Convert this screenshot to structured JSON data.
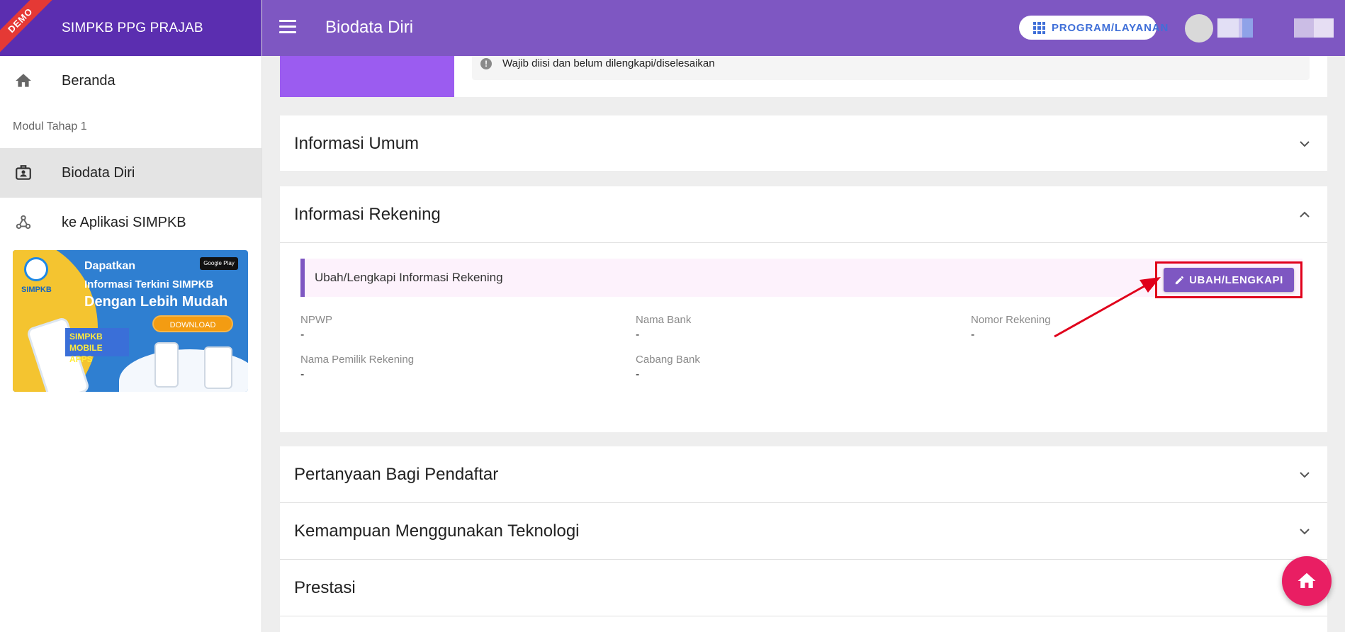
{
  "sidebar": {
    "brand": "SIMPKB PPG PRAJAB",
    "ribbon": "DEMO",
    "items": [
      {
        "label": "Beranda",
        "icon": "home-icon"
      },
      {
        "label": "Biodata Diri",
        "icon": "id-badge-icon"
      },
      {
        "label": "ke Aplikasi SIMPKB",
        "icon": "webhook-icon"
      }
    ],
    "section_label": "Modul Tahap 1",
    "banner": {
      "logo_text": "SIMPKB",
      "line1": "Dapatkan",
      "line2": "Informasi Terkini SIMPKB",
      "line3": "Dengan Lebih Mudah",
      "store_badge": "Google Play",
      "download": "DOWNLOAD",
      "apps_line1": "SIMPKB",
      "apps_line2": "MOBILE APPS"
    }
  },
  "topbar": {
    "title": "Biodata Diri",
    "program_button": "PROGRAM/LAYANAN"
  },
  "notice": {
    "text": "Wajib diisi dan belum dilengkapi/diselesaikan"
  },
  "panels": {
    "informasi_umum": "Informasi Umum",
    "informasi_rekening": {
      "title": "Informasi Rekening",
      "bar_text": "Ubah/Lengkapi Informasi Rekening",
      "edit_button": "UBAH/LENGKAPI",
      "fields": [
        {
          "label": "NPWP",
          "value": "-"
        },
        {
          "label": "Nama Bank",
          "value": "-"
        },
        {
          "label": "Nomor Rekening",
          "value": "-"
        },
        {
          "label": "Nama Pemilik Rekening",
          "value": "-"
        },
        {
          "label": "Cabang Bank",
          "value": "-"
        }
      ]
    },
    "pertanyaan": "Pertanyaan Bagi Pendaftar",
    "kemampuan": "Kemampuan Menggunakan Teknologi",
    "prestasi": "Prestasi"
  },
  "colors": {
    "brand_dark": "#5b2eb0",
    "topbar": "#7e57c2",
    "accent_button": "#7e57c2",
    "highlight": "#e0001b",
    "fab": "#e91e63"
  }
}
